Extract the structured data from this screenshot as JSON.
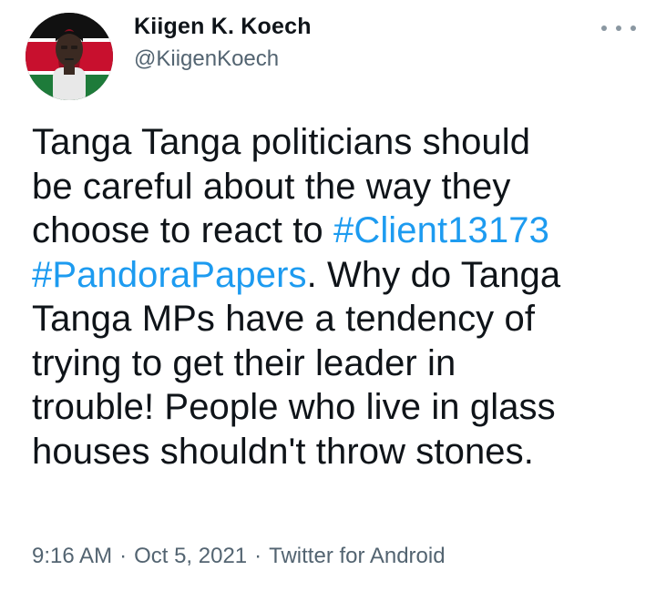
{
  "author": {
    "display_name": "Kiigen K. Koech",
    "handle": "@KiigenKoech",
    "avatar_icon": "profile-photo-kenya-flag"
  },
  "more_menu": {
    "icon": "more-horizontal-icon"
  },
  "tweet": {
    "lines": [
      [
        {
          "text": "Tanga Tanga politicians should",
          "hashtag": false
        }
      ],
      [
        {
          "text": "be careful about the way they",
          "hashtag": false
        }
      ],
      [
        {
          "text": "choose to react to ",
          "hashtag": false
        },
        {
          "text": "#Client13173",
          "hashtag": true
        }
      ],
      [
        {
          "text": "#PandoraPapers",
          "hashtag": true
        },
        {
          "text": ". Why do Tanga",
          "hashtag": false
        }
      ],
      [
        {
          "text": "Tanga MPs have a tendency of",
          "hashtag": false
        }
      ],
      [
        {
          "text": "trying to get their leader in",
          "hashtag": false
        }
      ],
      [
        {
          "text": "trouble! People who live in glass",
          "hashtag": false
        }
      ],
      [
        {
          "text": "houses shouldn't throw stones.",
          "hashtag": false
        }
      ]
    ]
  },
  "meta": {
    "time": "9:16 AM",
    "separator": "·",
    "date": "Oct 5, 2021",
    "source": "Twitter for Android"
  },
  "colors": {
    "text": "#0f1419",
    "secondary": "#536471",
    "link": "#1d9bf0",
    "background": "#ffffff"
  }
}
